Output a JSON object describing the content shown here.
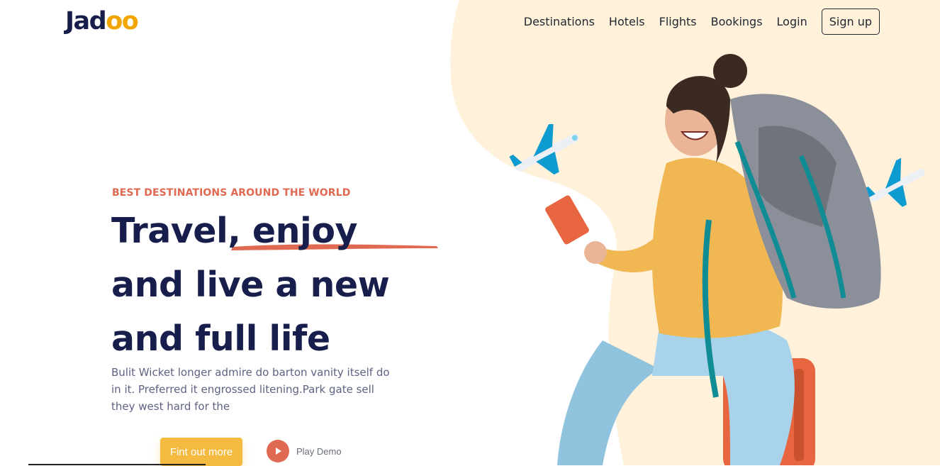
{
  "brand": {
    "logo_prefix": "Jad",
    "logo_accent": "oo"
  },
  "nav": {
    "links": [
      "Destinations",
      "Hotels",
      "Flights",
      "Bookings",
      "Login"
    ],
    "signup": "Sign up"
  },
  "hero": {
    "eyebrow": "BEST DESTINATIONS AROUND THE WORLD",
    "headline": [
      "Travel, enjoy",
      "and live a new",
      "and full life"
    ],
    "description": "Bulit Wicket longer admire do barton vanity itself do in it. Preferred it engrossed litening.Park gate sell they west hard for the",
    "cta_label": "Fint out more",
    "play_label": "Play Demo"
  },
  "colors": {
    "navy": "#181E4B",
    "orange": "#DF6951",
    "yellow": "#F1A501",
    "blob": "#FFF1DA",
    "text_grey": "#5E6282"
  },
  "icons": [
    "play-icon",
    "airplane-icon"
  ]
}
